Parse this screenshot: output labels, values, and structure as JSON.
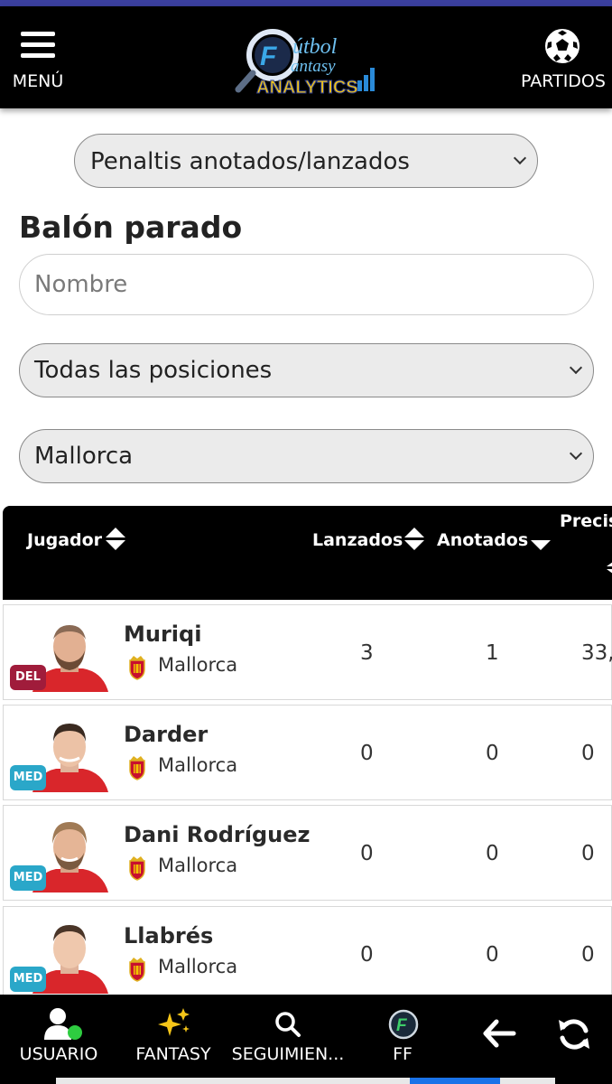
{
  "header": {
    "menu_label": "MENÚ",
    "logo_text": "Fútbol Fantasy ANALYTICS",
    "matches_label": "PARTIDOS"
  },
  "filters": {
    "stat_selected": "Penaltis anotados/lanzados",
    "section_title": "Balón parado",
    "name_placeholder": "Nombre",
    "position_selected": "Todas las posiciones",
    "team_selected": "Mallorca"
  },
  "table": {
    "columns": [
      "Jugador",
      "Lanzados",
      "Anotados",
      "Precis"
    ],
    "rows": [
      {
        "name": "Muriqi",
        "team": "Mallorca",
        "position": "DEL",
        "lanzados": "3",
        "anotados": "1",
        "precision": "33,"
      },
      {
        "name": "Darder",
        "team": "Mallorca",
        "position": "MED",
        "lanzados": "0",
        "anotados": "0",
        "precision": "0"
      },
      {
        "name": "Dani Rodríguez",
        "team": "Mallorca",
        "position": "MED",
        "lanzados": "0",
        "anotados": "0",
        "precision": "0"
      },
      {
        "name": "Llabrés",
        "team": "Mallorca",
        "position": "MED",
        "lanzados": "0",
        "anotados": "0",
        "precision": "0"
      }
    ]
  },
  "bottom_nav": {
    "items": [
      {
        "label": "USUARIO",
        "icon": "user-icon"
      },
      {
        "label": "FANTASY",
        "icon": "sparkles-icon"
      },
      {
        "label": "SEGUIMIEN...",
        "icon": "search-icon"
      },
      {
        "label": "FF",
        "icon": "ff-logo-icon"
      },
      {
        "label": "",
        "icon": "arrow-left-icon"
      },
      {
        "label": "",
        "icon": "refresh-icon"
      }
    ]
  },
  "colors": {
    "header_bg": "#000000",
    "accent_strip": "#3a3f9e",
    "badge_del": "#a01c3b",
    "badge_med": "#2aa7c9",
    "online_dot": "#2ecc40"
  }
}
